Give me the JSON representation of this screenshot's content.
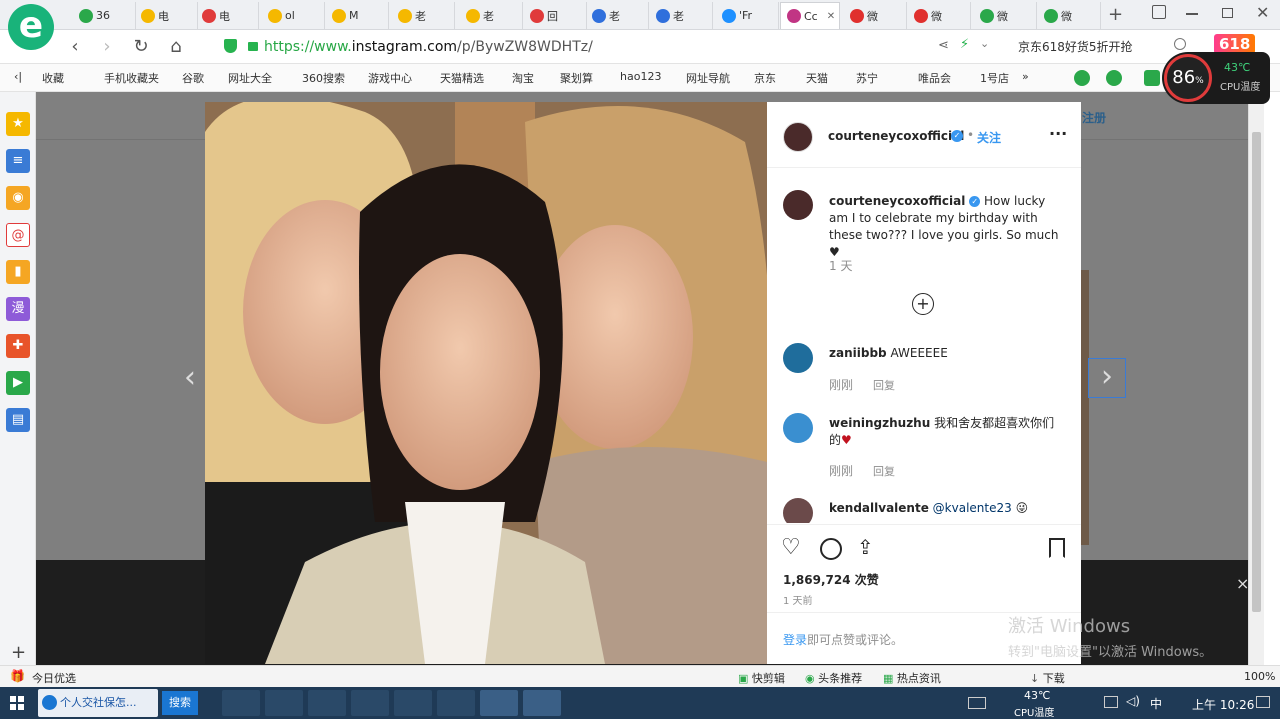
{
  "browser": {
    "tabs": [
      {
        "label": "36",
        "icon_color": "#2aa84a"
      },
      {
        "label": "电",
        "icon_color": "#f5b800"
      },
      {
        "label": "电",
        "icon_color": "#e03b3b"
      },
      {
        "label": "ol",
        "icon_color": "#f5b800"
      },
      {
        "label": "M",
        "icon_color": "#f5b800"
      },
      {
        "label": "老",
        "icon_color": "#f5b800"
      },
      {
        "label": "老",
        "icon_color": "#f5b800"
      },
      {
        "label": "回",
        "icon_color": "#e03b3b"
      },
      {
        "label": "老",
        "icon_color": "#2f6fdc"
      },
      {
        "label": "老",
        "icon_color": "#2f6fdc"
      },
      {
        "label": "'Fr",
        "icon_color": "#1e90ff"
      },
      {
        "label": "Cc",
        "icon_color": "#c13584"
      },
      {
        "label": "微",
        "icon_color": "#e0302e"
      },
      {
        "label": "微",
        "icon_color": "#e0302e"
      },
      {
        "label": "微",
        "icon_color": "#2aa84a"
      },
      {
        "label": "微",
        "icon_color": "#2aa84a"
      }
    ],
    "url_prefix": "https://www.",
    "url_host": "instagram.com",
    "url_path": "/p/BywZW8WDHTz/",
    "search_promo": "京东618好货5折开抢",
    "promo_badge": "618",
    "favorites": [
      "收藏",
      "手机收藏夹",
      "谷歌",
      "网址大全",
      "360搜索",
      "游戏中心",
      "天猫精选",
      "淘宝",
      "聚划算",
      "hao123",
      "网址导航",
      "京东",
      "天猫",
      "苏宁",
      "唯品会",
      "1号店"
    ],
    "fav_more": "»",
    "cpu": {
      "percent": "86",
      "percent_sign": "%",
      "temp": "43℃",
      "label": "CPU温度"
    }
  },
  "page": {
    "header_right": "注册",
    "post": {
      "author": "courteneycoxofficial",
      "follow_label": "关注",
      "dot": "•",
      "caption": "How lucky am I to celebrate my birthday with these two??? I love you girls. So much ♥",
      "caption_time": "1 天",
      "comments": [
        {
          "user": "zaniibbb",
          "text": "AWEEEEE",
          "time": "刚刚",
          "reply": "回复",
          "avatar_color": "#1f6d9c"
        },
        {
          "user": "weiningzhuzhu",
          "text": "我和舍友都超喜欢你们的",
          "heart": "♥",
          "time": "刚刚",
          "reply": "回复",
          "avatar_color": "#3a8fd0"
        },
        {
          "user": "kendallvalente",
          "mention": "@kvalente23",
          "emoji": "😜",
          "avatar_color": "#6b4a4a"
        }
      ],
      "likes": "1,869,724 次赞",
      "post_time": "1 天前",
      "login_link": "登录",
      "login_text": "即可点赞或评论。"
    },
    "watermark_line1": "激活 Windows",
    "watermark_line2": "转到\"电脑设置\"以激活 Windows。",
    "close_x": "×"
  },
  "statusbar": {
    "left": "今日优选",
    "items": [
      "快剪辑",
      "头条推荐",
      "热点资讯",
      "下载"
    ],
    "zoom": "100%"
  },
  "taskbar": {
    "item_title": "个人交社保怎...",
    "search_btn": "搜索",
    "temp": "43℃",
    "temp_label": "CPU温度",
    "ime": "中",
    "time": "上午 10:26"
  }
}
